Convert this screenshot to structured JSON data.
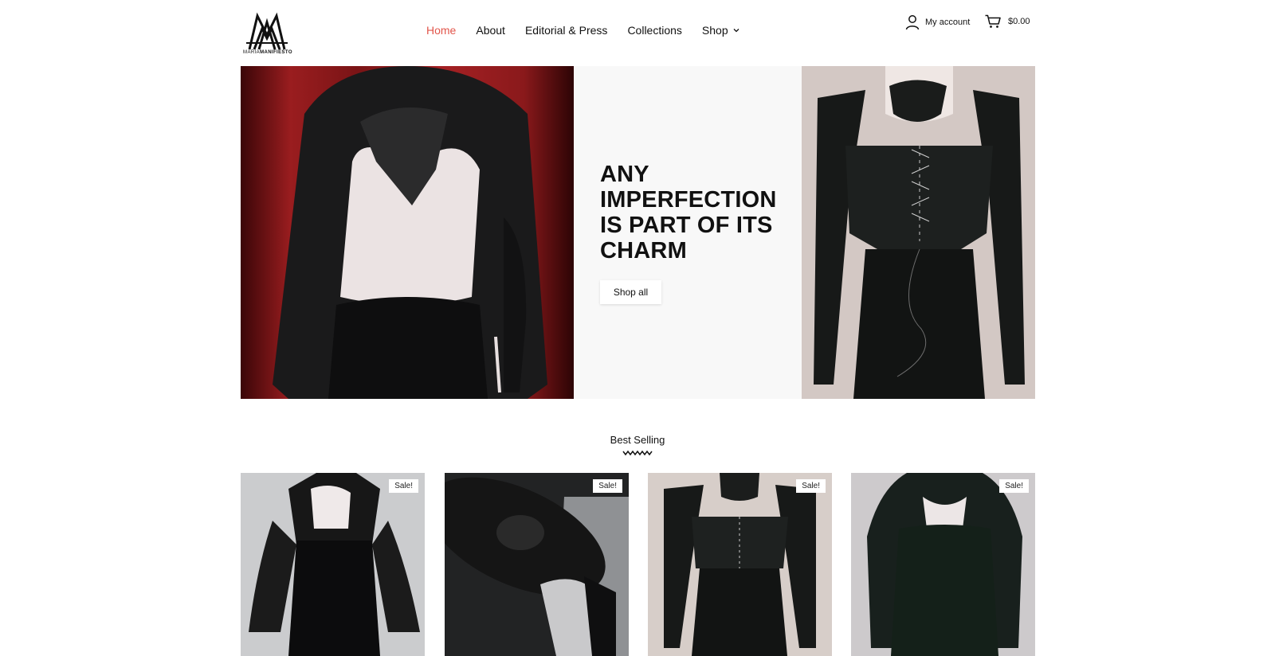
{
  "brand": {
    "logo_text_light": "MARIA",
    "logo_text_bold": "MANIFIESTO"
  },
  "nav": {
    "items": [
      {
        "label": "Home",
        "active": true
      },
      {
        "label": "About",
        "active": false
      },
      {
        "label": "Editorial & Press",
        "active": false
      },
      {
        "label": "Collections",
        "active": false
      },
      {
        "label": "Shop",
        "active": false,
        "has_dropdown": true
      }
    ]
  },
  "account": {
    "label": "My account",
    "icon": "user-icon"
  },
  "cart": {
    "label": "$0.00",
    "icon": "cart-icon"
  },
  "hero": {
    "title": "ANY IMPERFECTION IS PART OF ITS CHARM",
    "button_label": "Shop all"
  },
  "best_selling": {
    "title": "Best Selling",
    "products": [
      {
        "badge": "Sale!"
      },
      {
        "badge": "Sale!"
      },
      {
        "badge": "Sale!"
      },
      {
        "badge": "Sale!"
      }
    ]
  },
  "colors": {
    "accent": "#e2564b",
    "text": "#111111",
    "hero_panel": "#f8f8f8"
  }
}
